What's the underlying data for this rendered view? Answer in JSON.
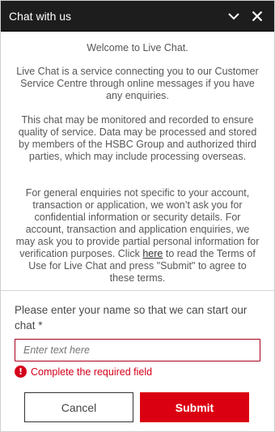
{
  "header": {
    "title": "Chat with us",
    "minimize_icon": "chevron-down-icon",
    "close_icon": "close-icon"
  },
  "intro": {
    "welcome": "Welcome to Live Chat.",
    "service": "Live Chat is a service connecting you to our Customer Service Centre through online messages if you have any enquiries.",
    "monitoring": "This chat may be monitored and recorded to ensure quality of service. Data may be processed and stored by members of the HSBC Group and authorized third parties, which may include processing overseas.",
    "enquiry_before_link": "For general enquiries not specific to your account, transaction or application, we won’t ask you for confidential information or security details. For account, transaction and application enquiries, we may ask you to provide partial personal information for verification purposes. Click ",
    "enquiry_link": "here",
    "enquiry_after_link": " to read the Terms of Use for Live Chat and press \"Submit\" to agree to these terms."
  },
  "form": {
    "name_label": "Please enter your name so that we can start our chat *",
    "name_value": "",
    "name_placeholder": "Enter text here",
    "error_text": "Complete the required field",
    "error_icon": "exclamation-icon"
  },
  "actions": {
    "cancel_label": "Cancel",
    "submit_label": "Submit"
  },
  "colors": {
    "header_bg": "#1d1d1d",
    "accent_red": "#db0011",
    "error_red": "#d4001a"
  }
}
